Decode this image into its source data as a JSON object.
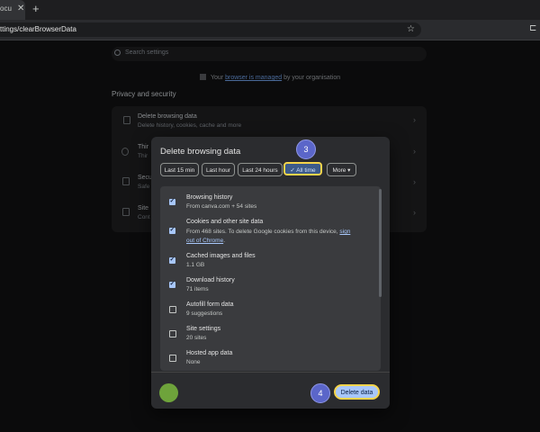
{
  "browser": {
    "tab_title": "ocu",
    "tab_close": "✕",
    "new_tab": "+",
    "url": "ttings/clearBrowserData",
    "star": "☆",
    "extension": "⊏"
  },
  "settings": {
    "search_placeholder": "Search settings",
    "managed_before": "Your ",
    "managed_link": "browser is managed",
    "managed_after": " by your organisation",
    "section_title": "Privacy and security",
    "rows": [
      {
        "title": "Delete browsing data",
        "subtitle": "Delete history, cookies, cache and more"
      },
      {
        "title": "Thir",
        "subtitle": "Thir"
      },
      {
        "title": "Secu",
        "subtitle": "Safe"
      },
      {
        "title": "Site",
        "subtitle": "Cont"
      }
    ],
    "chevron": "›"
  },
  "dialog": {
    "title": "Delete browsing data",
    "time_ranges": [
      "Last 15 min",
      "Last hour",
      "Last 24 hours",
      "✓ All time",
      "More ▾"
    ],
    "selected_range": "All time",
    "items": [
      {
        "title": "Browsing history",
        "subtitle": "From canva.com + 54 sites",
        "checked": true
      },
      {
        "title": "Cookies and other site data",
        "subtitle_before": "From 468 sites. To delete Google cookies from this device, ",
        "subtitle_link1": "sign",
        "subtitle_link2": "out of Chrome",
        "subtitle_after": ".",
        "checked": true
      },
      {
        "title": "Cached images and files",
        "subtitle": "1.1 GB",
        "checked": true
      },
      {
        "title": "Download history",
        "subtitle": "71 items",
        "checked": true
      },
      {
        "title": "Autofill form data",
        "subtitle": "9 suggestions",
        "checked": false
      },
      {
        "title": "Site settings",
        "subtitle": "20 sites",
        "checked": false
      },
      {
        "title": "Hosted app data",
        "subtitle": "None",
        "checked": false
      }
    ],
    "delete_label": "Delete data"
  },
  "annotations": {
    "step_all_time": "3",
    "step_delete": "4",
    "highlight_color": "#f5d44b",
    "badge_color": "#5b66c9"
  }
}
